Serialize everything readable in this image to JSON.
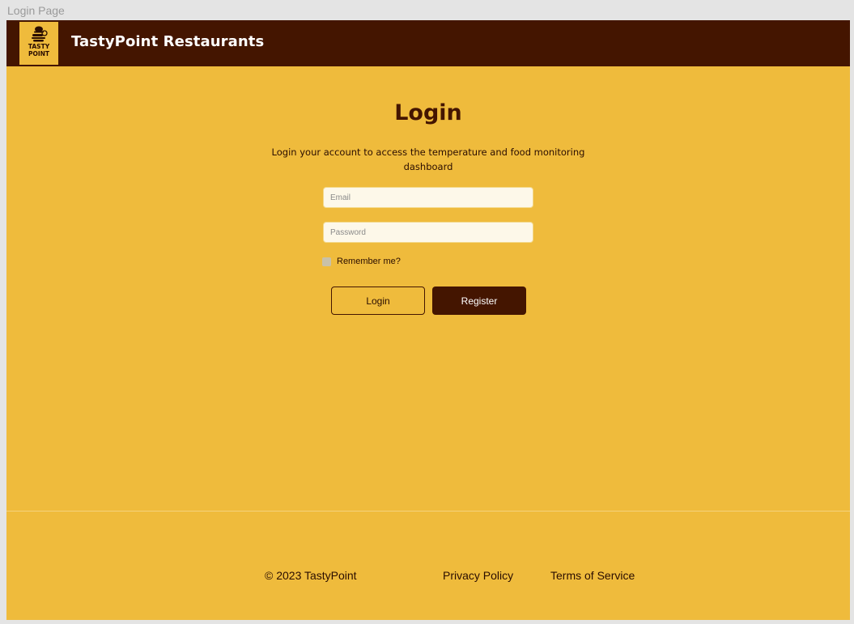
{
  "frame": {
    "label": "Login Page"
  },
  "header": {
    "logo_text_top": "TASTY",
    "logo_text_bottom": "POINT",
    "title": "TastyPoint Restaurants"
  },
  "login": {
    "title": "Login",
    "subtitle": "Login your account to access the temperature and food monitoring dashboard",
    "email_placeholder": "Email",
    "email_value": "",
    "password_placeholder": "Password",
    "password_value": "",
    "remember_label": "Remember me?",
    "remember_checked": false,
    "login_button": "Login",
    "register_button": "Register"
  },
  "footer": {
    "copyright": "© 2023 TastyPoint",
    "privacy": "Privacy Policy",
    "terms": "Terms of Service"
  },
  "colors": {
    "background": "#efbb3c",
    "brand_dark": "#441500",
    "field_bg": "#fdf8e9",
    "text_light": "#ffffff"
  },
  "icons": {
    "logo": "burger-logo-icon"
  }
}
